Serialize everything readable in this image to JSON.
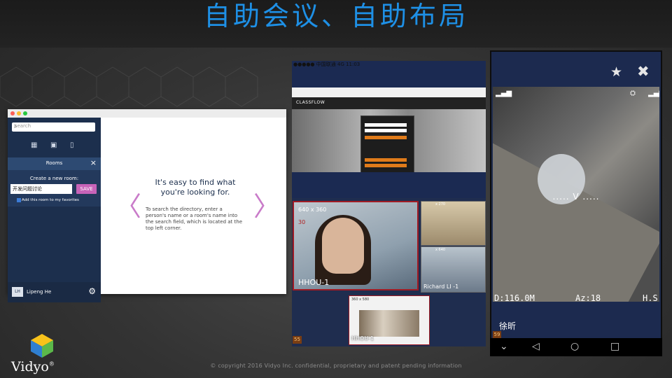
{
  "slide": {
    "title": "自助会议、自助布局",
    "copyright": "© copyright  2016 Vidyo Inc.  confidential,  proprietary  and patent pending  information",
    "logo": {
      "name": "Vidyo",
      "mark": "®"
    }
  },
  "app_window": {
    "search": {
      "placeholder": "Search"
    },
    "nav_icons": [
      "calendar-icon",
      "contacts-icon",
      "rooms-icon"
    ],
    "rooms_panel": {
      "title": "Rooms",
      "create_label": "Create a new room:",
      "room_name_value": "开发问题讨论",
      "save_label": "SAVE",
      "favorites_label": "Add this room to my favorites",
      "favorites_checked": true
    },
    "user": {
      "initials": "LH",
      "name": "Lipeng He"
    },
    "main": {
      "headline": "It's easy to find what you're looking for.",
      "description": "To search the directory, enter a person's name or a room's name into the search field, which is located at the top left corner."
    }
  },
  "video_conference": {
    "status_bar": "●●●●● 中国联通  4G      11:03",
    "share_app": "CLASSFLOW",
    "main_participant": {
      "resolution": "640 x 360",
      "fps": "30",
      "name": "HHOU-1"
    },
    "participants": [
      {
        "resolution": "x 270",
        "name": ""
      },
      {
        "resolution": "x 640",
        "name": "Richard LI -1"
      }
    ],
    "self_view": {
      "resolution": "360 x 580",
      "name": "HHOU-1"
    },
    "counter": "55"
  },
  "phone_call": {
    "actions": [
      "star-icon",
      "close-icon"
    ],
    "hud": {
      "distance": "D:116.0M",
      "azimuth": "Az:18",
      "hs": "H.S:("
    },
    "reticle": "..... V .....",
    "caller_name": "徐昕",
    "counter": "59",
    "nav_keys": [
      "⌄",
      "◁",
      "○",
      "□"
    ]
  },
  "colors": {
    "title": "#1e90e6",
    "save_button": "#c763b8",
    "sidebar": "#1c2f4d",
    "video_bg": "#1f2d4f",
    "border_active": "#a01b24"
  }
}
